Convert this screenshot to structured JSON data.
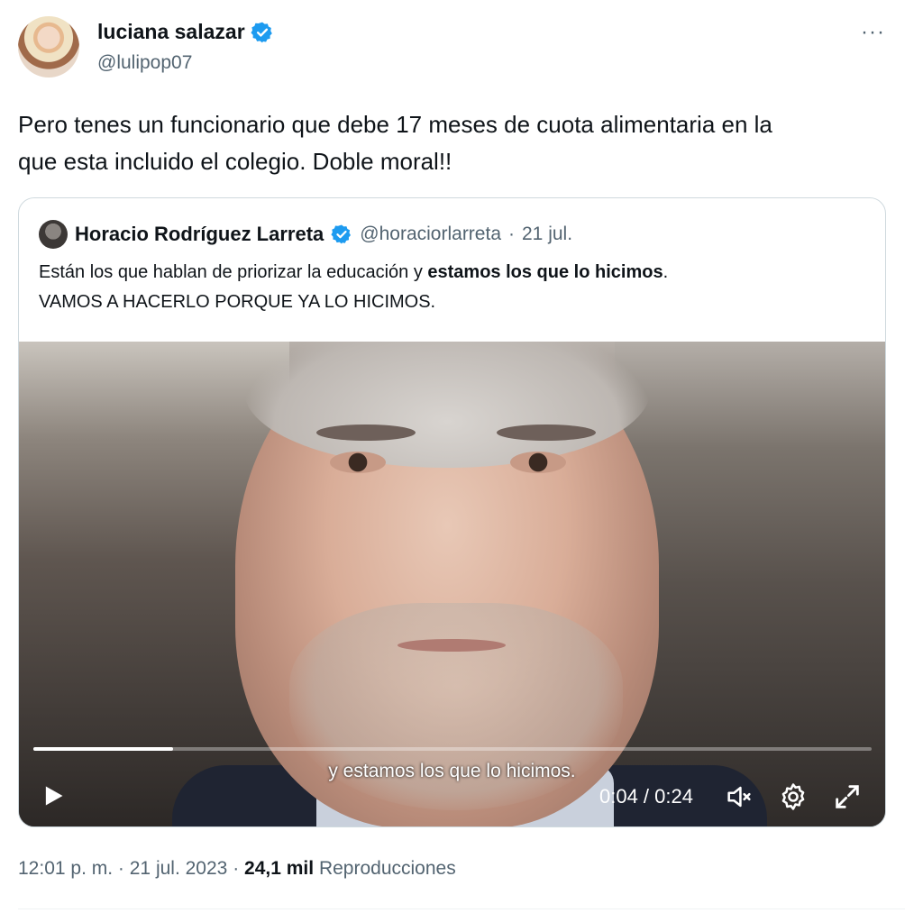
{
  "author": {
    "display_name": "luciana salazar",
    "handle": "@lulipop07",
    "verified_icon": "verified-badge-icon",
    "more_label": "···"
  },
  "tweet": {
    "text_line1": "Pero tenes un funcionario que debe 17 meses de cuota alimentaria en la",
    "text_line2": "que esta incluido el colegio. Doble moral!!"
  },
  "quote": {
    "display_name": "Horacio Rodríguez Larreta",
    "handle": "@horaciorlarreta",
    "separator": "·",
    "date": "21 jul.",
    "text_part1": "Están los que hablan de priorizar la educación y ",
    "text_bold": "estamos los que lo hicimos",
    "text_part2": ".",
    "text_line2": "VAMOS A HACERLO PORQUE YA LO HICIMOS."
  },
  "video": {
    "subtitle": "y estamos los que lo hicimos.",
    "time": "0:04 / 0:24",
    "progress_fraction": 0.1667,
    "icons": [
      "play-icon",
      "mute-icon",
      "settings-icon",
      "fullscreen-icon"
    ]
  },
  "footer": {
    "time": "12:01 p. m.",
    "sep1": "·",
    "date": "21 jul. 2023",
    "sep2": "·",
    "views_count": "24,1 mil",
    "views_label": "Reproducciones"
  },
  "colors": {
    "accent": "#1d9bf0",
    "text": "#0f1419",
    "secondary": "#536471",
    "border": "#cfd9de"
  }
}
